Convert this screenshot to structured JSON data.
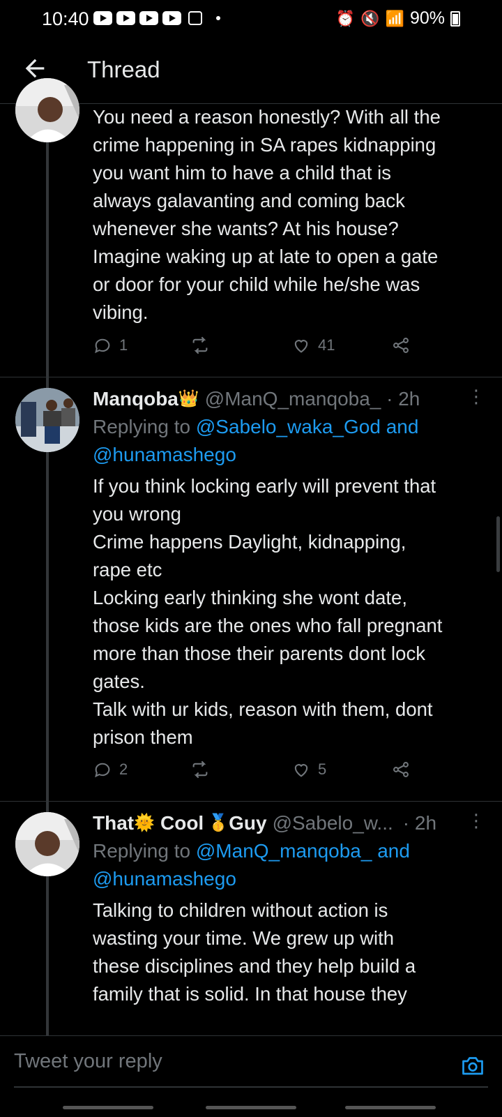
{
  "status_bar": {
    "time": "10:40",
    "battery": "90%"
  },
  "header": {
    "title": "Thread"
  },
  "tweets": [
    {
      "text": "You need a reason honestly? With all the\ncrime happening in SA rapes kidnapping\nyou want him to have a child that is\nalways galavanting and coming back\nwhenever she wants? At his house?\nImagine waking up at late to open a gate\nor door for your child while he/she was\nvibing.",
      "replies": "1",
      "retweets": "",
      "likes": "41"
    },
    {
      "name": "Manqoba",
      "name_emoji": "👑",
      "handle": "@ManQ_manqoba_ · 2h",
      "replying_prefix": "Replying to ",
      "replying_line1": "@Sabelo_waka_God and",
      "replying_line2": "@hunamashego",
      "text": "If you think locking early will prevent that\nyou wrong\nCrime happens Daylight, kidnapping,\nrape etc\nLocking early thinking she wont date,\nthose kids are the ones who fall pregnant\nmore than those their parents dont lock\ngates.\nTalk with ur kids, reason with them, dont\nprison them",
      "replies": "2",
      "retweets": "",
      "likes": "5"
    },
    {
      "name_part1": "That",
      "emoji1": "🌞",
      "name_part2": "Cool",
      "emoji2": "🥇",
      "name_part3": "Guy",
      "handle": "@Sabelo_w...",
      "time": "· 2h",
      "replying_prefix": "Replying to ",
      "replying_line1": "@ManQ_manqoba_ and",
      "replying_line2": "@hunamashego",
      "text": "Talking to children without action is\nwasting your  time. We grew up with\nthese disciplines and they help build a\nfamily that is solid. In that house they"
    }
  ],
  "reply_box": {
    "placeholder": "Tweet your reply"
  },
  "icons": {
    "back": "arrow-left-icon",
    "reply": "comment-icon",
    "retweet": "retweet-icon",
    "like": "heart-icon",
    "share": "share-icon",
    "more": "more-vertical-icon",
    "camera": "camera-icon"
  },
  "colors": {
    "background": "#000000",
    "text": "#e7e9ea",
    "muted": "#71767b",
    "link": "#1d9bf0",
    "accent": "#1d9bf0"
  }
}
